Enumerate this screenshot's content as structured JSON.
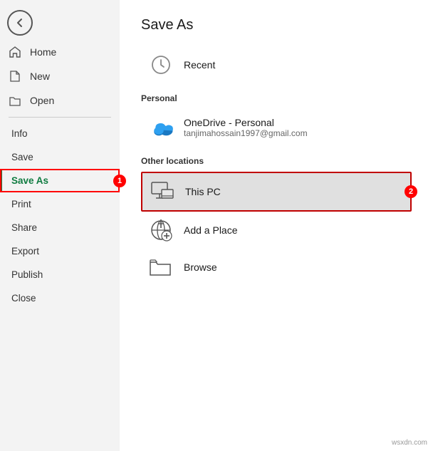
{
  "sidebar": {
    "back_label": "←",
    "items": [
      {
        "id": "home",
        "label": "Home",
        "icon": "home"
      },
      {
        "id": "new",
        "label": "New",
        "icon": "new"
      },
      {
        "id": "open",
        "label": "Open",
        "icon": "open"
      }
    ],
    "text_items": [
      {
        "id": "info",
        "label": "Info",
        "active": false
      },
      {
        "id": "save",
        "label": "Save",
        "active": false
      },
      {
        "id": "save-as",
        "label": "Save As",
        "active": true
      },
      {
        "id": "print",
        "label": "Print",
        "active": false
      },
      {
        "id": "share",
        "label": "Share",
        "active": false
      },
      {
        "id": "export",
        "label": "Export",
        "active": false
      },
      {
        "id": "publish",
        "label": "Publish",
        "active": false
      },
      {
        "id": "close",
        "label": "Close",
        "active": false
      }
    ]
  },
  "main": {
    "title": "Save As",
    "sections": [
      {
        "id": "recent-section",
        "items": [
          {
            "id": "recent",
            "name": "Recent",
            "sub": "",
            "icon": "clock"
          }
        ]
      },
      {
        "id": "personal-section",
        "label": "Personal",
        "items": [
          {
            "id": "onedrive",
            "name": "OneDrive - Personal",
            "sub": "tanjimahossain1997@gmail.com",
            "icon": "onedrive"
          }
        ]
      },
      {
        "id": "other-section",
        "label": "Other locations",
        "items": [
          {
            "id": "this-pc",
            "name": "This PC",
            "sub": "",
            "icon": "thispc",
            "highlighted": true
          },
          {
            "id": "add-place",
            "name": "Add a Place",
            "sub": "",
            "icon": "addplace"
          },
          {
            "id": "browse",
            "name": "Browse",
            "sub": "",
            "icon": "browse"
          }
        ]
      }
    ]
  },
  "annotations": {
    "badge1": "1",
    "badge2": "2"
  },
  "watermark": "wsxdn.com"
}
